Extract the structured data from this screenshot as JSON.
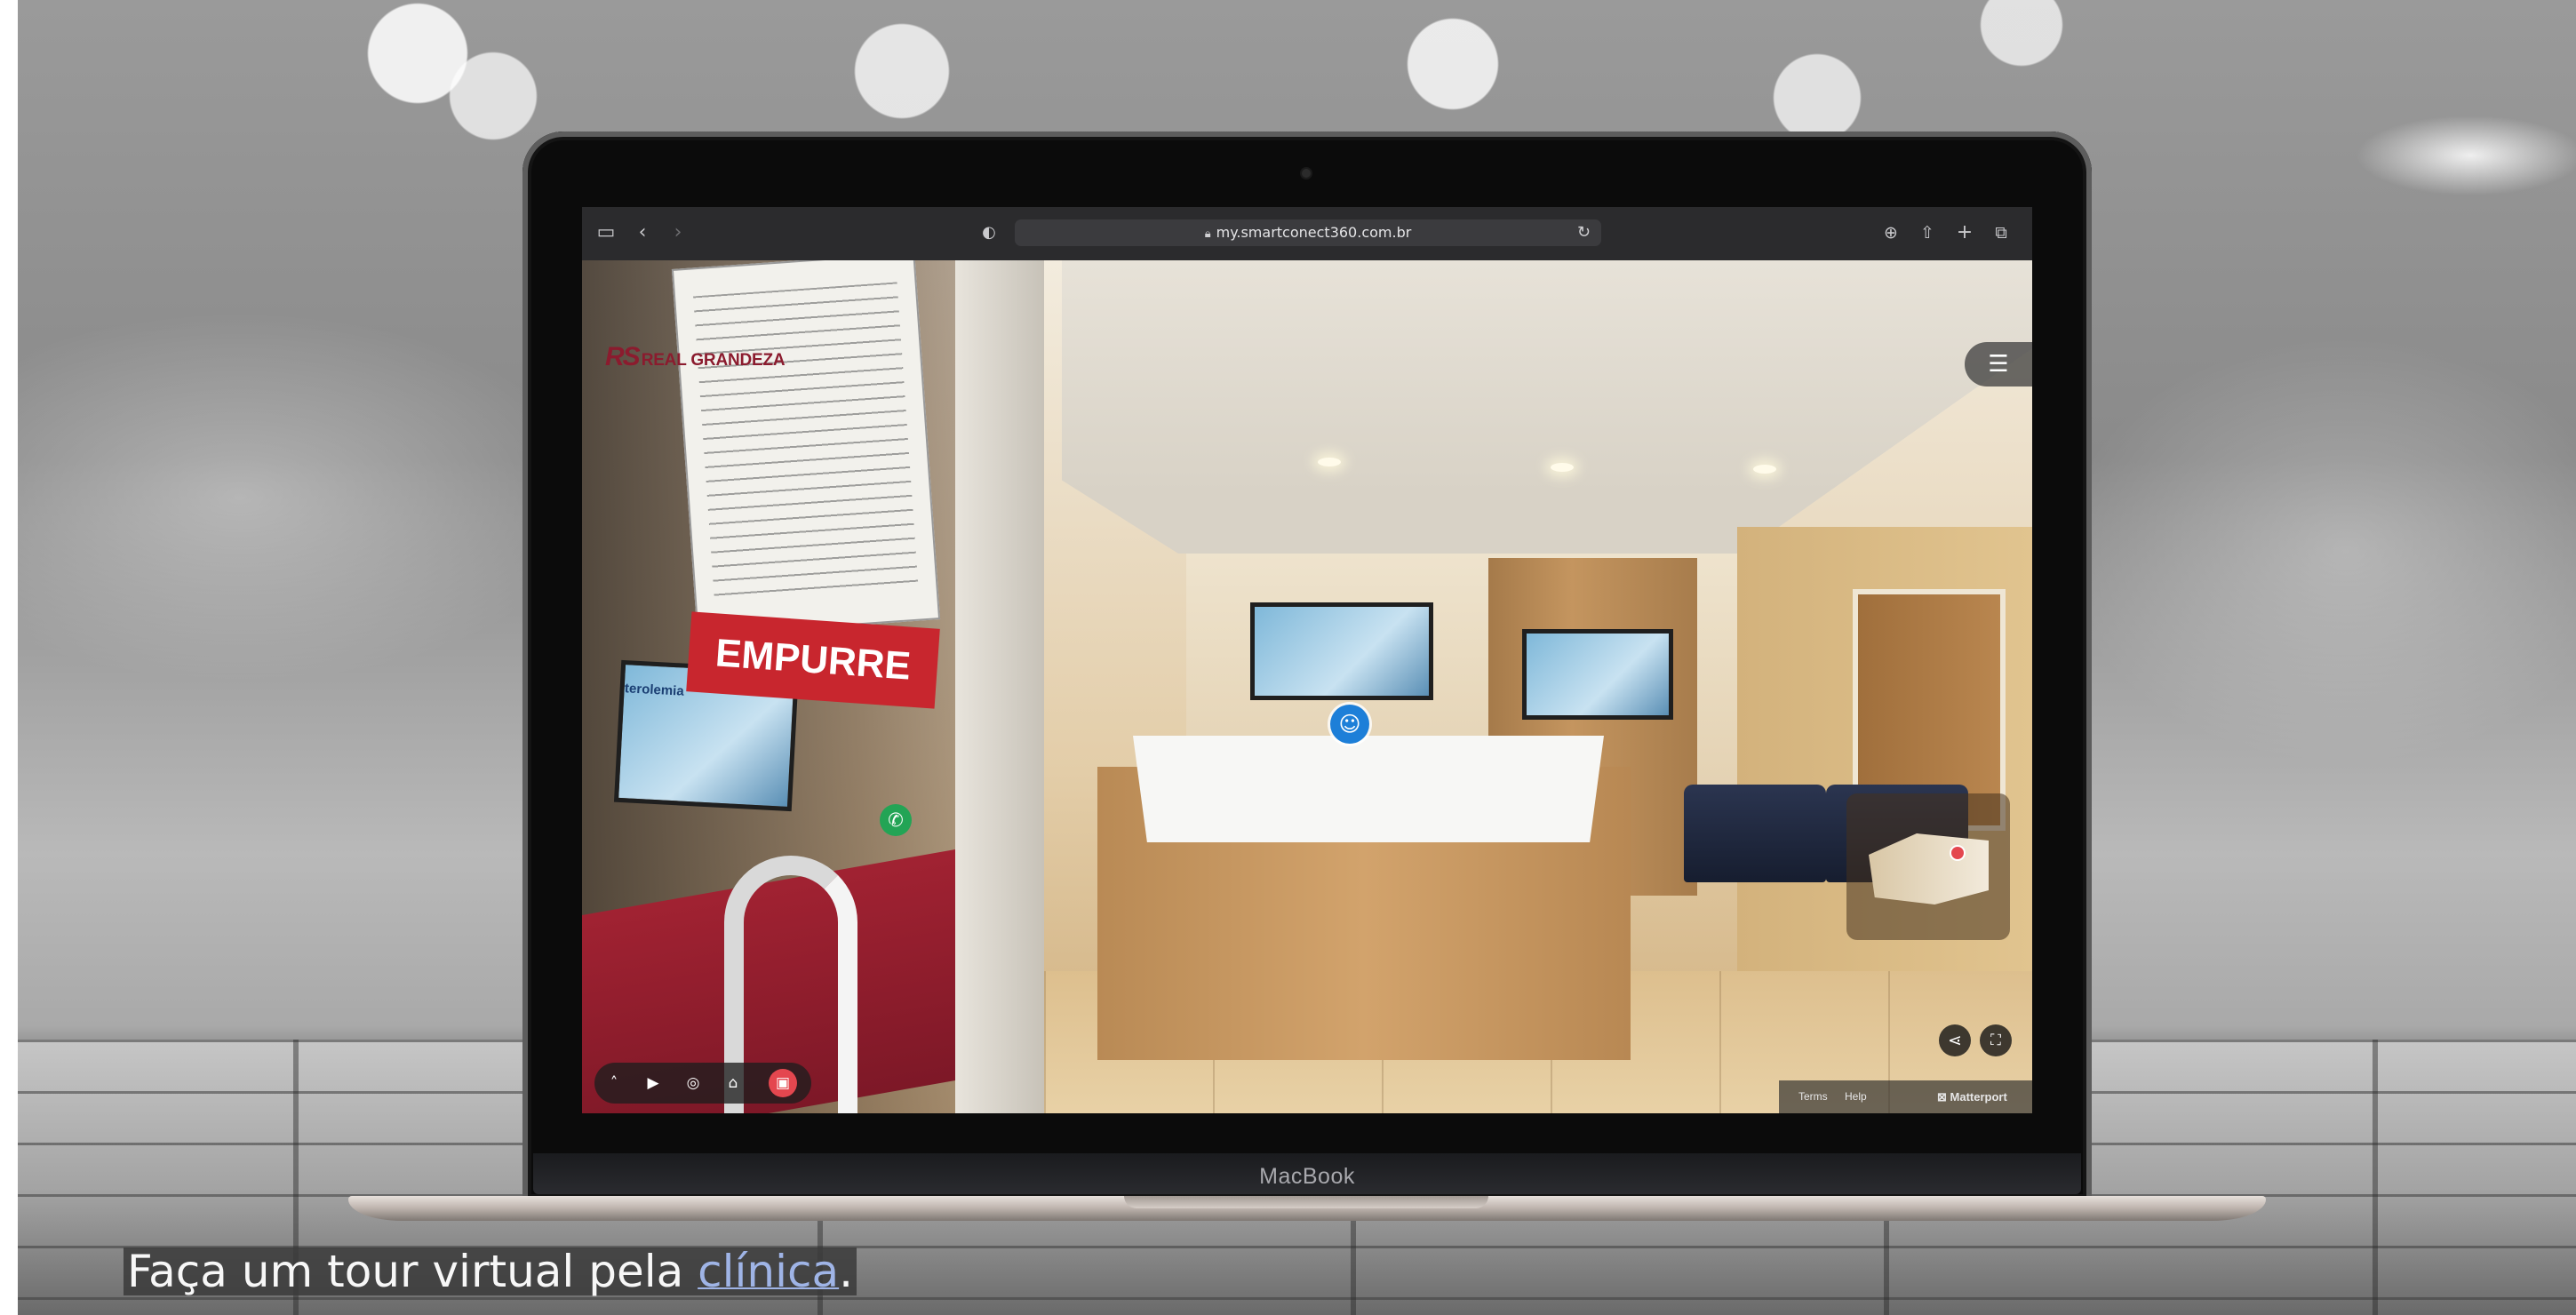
{
  "browser": {
    "url": "my.smartconect360.com.br",
    "icons": [
      "sidebar-icon",
      "back-icon",
      "forward-icon",
      "shield-icon",
      "lock-icon",
      "reload-icon",
      "download-icon",
      "share-icon",
      "new-tab-icon",
      "tabs-icon"
    ]
  },
  "tour": {
    "logo_mark": "RS",
    "logo_text": "REAL GRANDEZA",
    "sign_text": "EMPURRE",
    "tv_label": "terolemia",
    "toolbar_icons": [
      "chevron-up-icon",
      "play-icon",
      "view-3d-icon",
      "floorplan-icon",
      "dollhouse-icon"
    ],
    "footer": {
      "terms": "Terms",
      "help": "Help",
      "brand": "Matterport"
    },
    "accent": "#e4474f"
  },
  "laptop": {
    "model": "MacBook"
  },
  "caption": {
    "text_before": "Faça um tour virtual pela ",
    "link_text": "clínica",
    "text_after": "."
  }
}
